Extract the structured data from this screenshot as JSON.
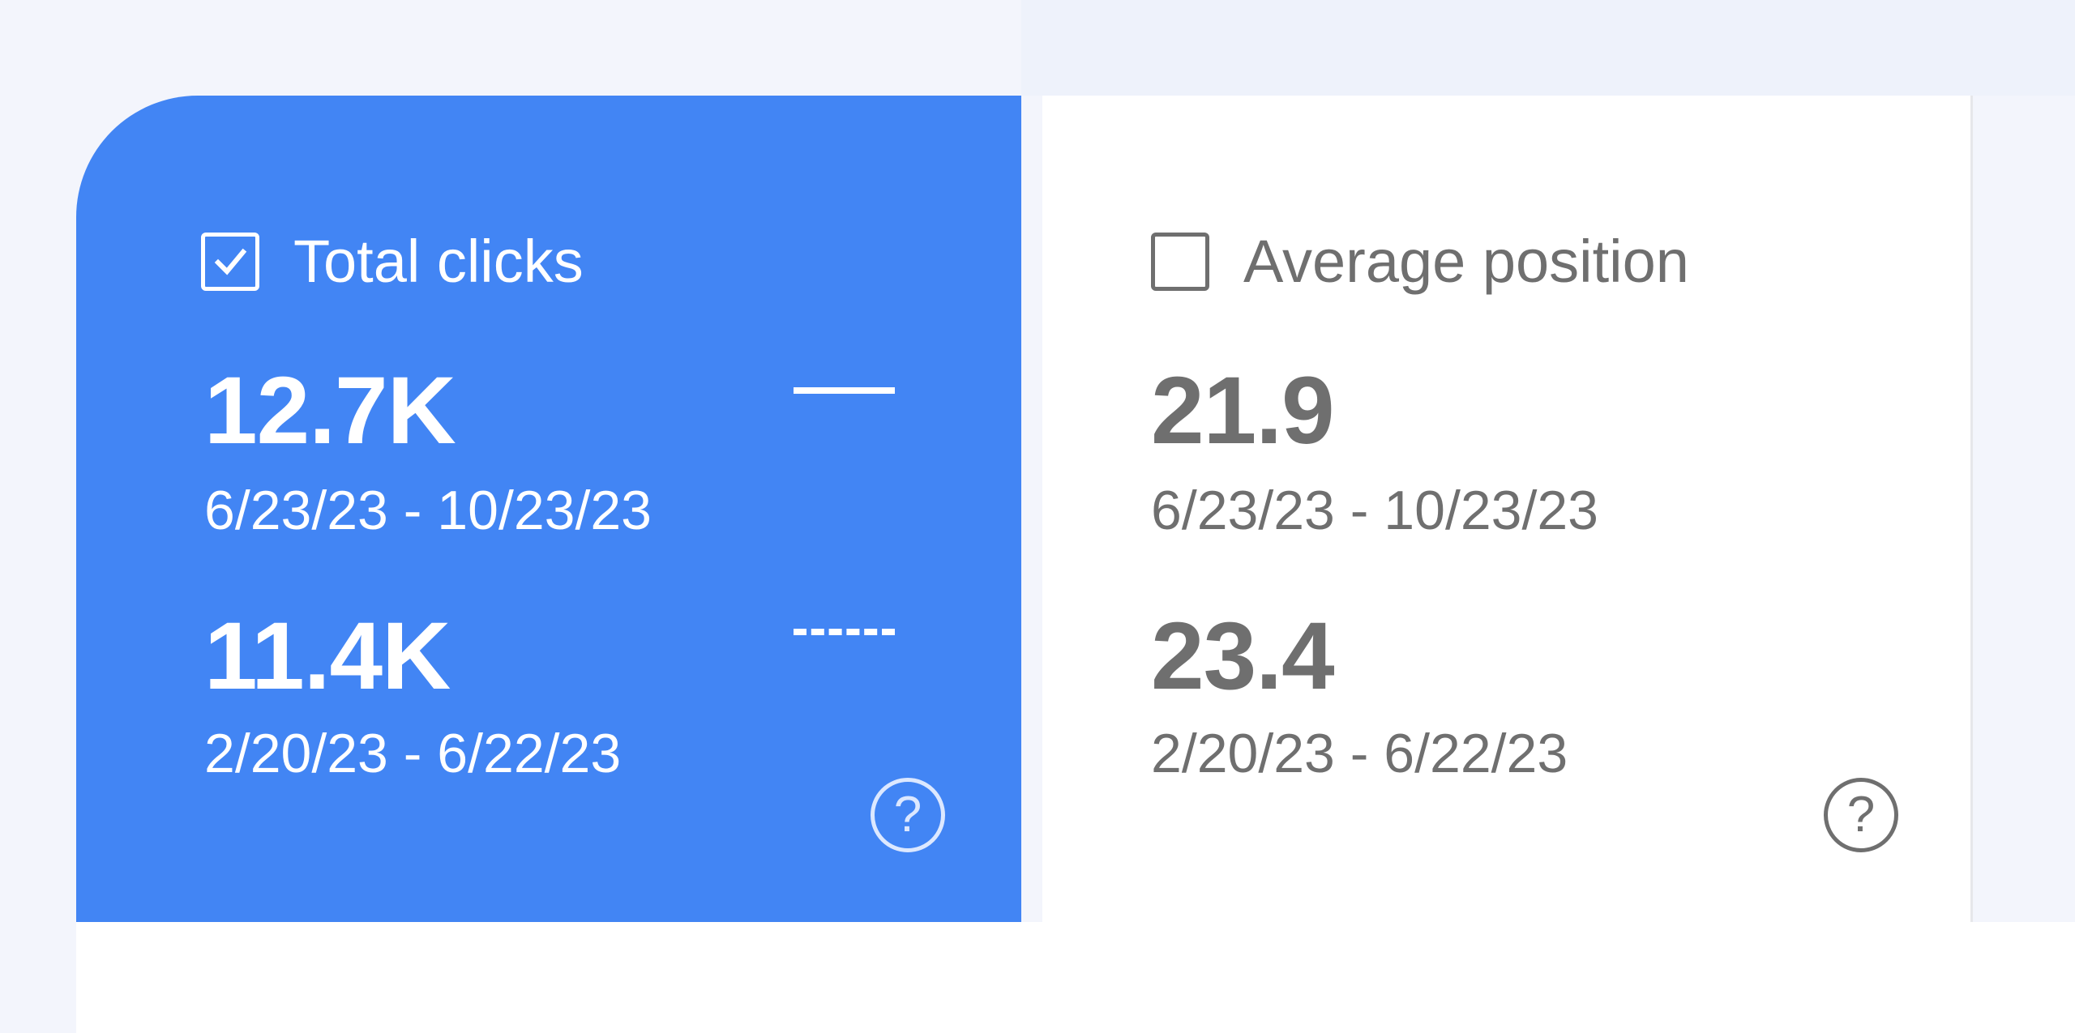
{
  "cards": {
    "total_clicks": {
      "label": "Total clicks",
      "checked": true,
      "current_value": "12.7K",
      "current_range": "6/23/23 - 10/23/23",
      "previous_value": "11.4K",
      "previous_range": "2/20/23 - 6/22/23",
      "help_label": "?"
    },
    "average_position": {
      "label": "Average position",
      "checked": false,
      "current_value": "21.9",
      "current_range": "6/23/23 - 10/23/23",
      "previous_value": "23.4",
      "previous_range": "2/20/23 - 6/22/23",
      "help_label": "?"
    }
  },
  "colors": {
    "active_card": "#4285f4",
    "inactive_card": "#ffffff",
    "page_background": "#f3f5fc",
    "inactive_text": "#6f6f6f"
  }
}
